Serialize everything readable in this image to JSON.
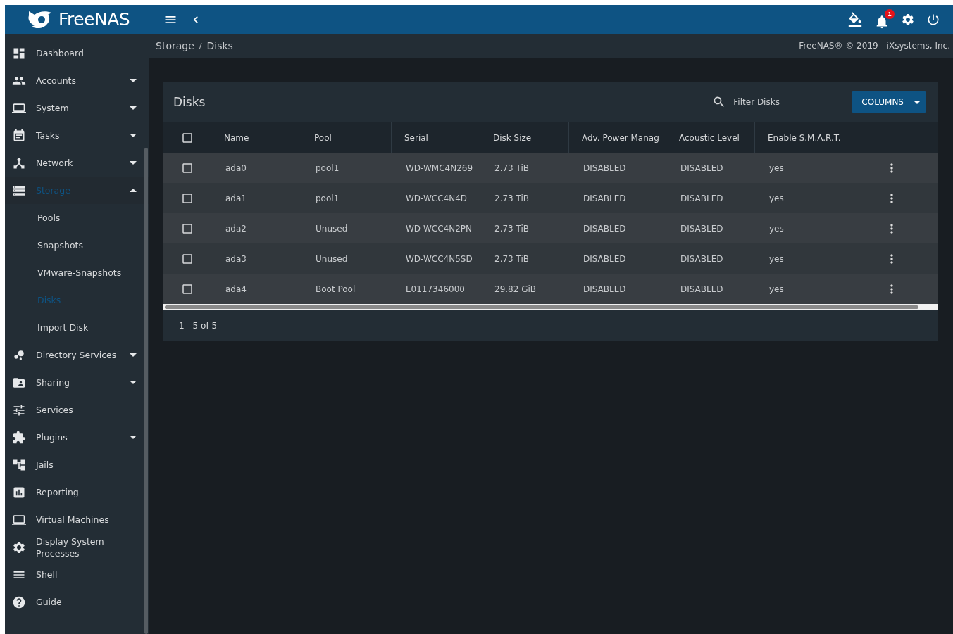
{
  "topbar": {
    "logo": "FreeNAS",
    "notification_count": "1"
  },
  "breadcrumb": {
    "items": [
      "Storage",
      "Disks"
    ],
    "separator": "/",
    "copyright": "FreeNAS® © 2019 - iXsystems, Inc."
  },
  "sidebar": {
    "items": [
      {
        "label": "Dashboard",
        "selected": false
      },
      {
        "label": "Accounts",
        "expanded": false,
        "selected": false
      },
      {
        "label": "System",
        "expanded": false,
        "selected": false
      },
      {
        "label": "Tasks",
        "expanded": false,
        "selected": false
      },
      {
        "label": "Network",
        "expanded": false,
        "selected": false
      },
      {
        "label": "Storage",
        "expanded": true,
        "selected": true,
        "children": [
          {
            "label": "Pools",
            "selected": false
          },
          {
            "label": "Snapshots",
            "selected": false
          },
          {
            "label": "VMware-Snapshots",
            "selected": false
          },
          {
            "label": "Disks",
            "selected": true
          },
          {
            "label": "Import Disk",
            "selected": false
          }
        ]
      },
      {
        "label": "Directory Services",
        "expanded": false,
        "selected": false
      },
      {
        "label": "Sharing",
        "expanded": false,
        "selected": false
      },
      {
        "label": "Services",
        "selected": false
      },
      {
        "label": "Plugins",
        "expanded": false,
        "selected": false
      },
      {
        "label": "Jails",
        "selected": false
      },
      {
        "label": "Reporting",
        "selected": false
      },
      {
        "label": "Virtual Machines",
        "selected": false
      },
      {
        "label": "Display System Processes",
        "selected": false
      },
      {
        "label": "Shell",
        "selected": false
      },
      {
        "label": "Guide",
        "selected": false
      }
    ]
  },
  "card": {
    "title": "Disks",
    "filter": {
      "placeholder": "Filter Disks"
    },
    "columns_button": "COLUMNS",
    "table": {
      "select_all_checked": false,
      "columns": [
        "Name",
        "Pool",
        "Serial",
        "Disk Size",
        "Adv. Power Manag",
        "Acoustic Level",
        "Enable S.M.A.R.T."
      ],
      "rows": [
        {
          "checked": false,
          "cells": [
            "ada0",
            "pool1",
            "WD-WMC4N269",
            "2.73 TiB",
            "DISABLED",
            "DISABLED",
            "yes"
          ]
        },
        {
          "checked": false,
          "cells": [
            "ada1",
            "pool1",
            "WD-WCC4N4D",
            "2.73 TiB",
            "DISABLED",
            "DISABLED",
            "yes"
          ]
        },
        {
          "checked": false,
          "cells": [
            "ada2",
            "Unused",
            "WD-WCC4N2PN",
            "2.73 TiB",
            "DISABLED",
            "DISABLED",
            "yes"
          ]
        },
        {
          "checked": false,
          "cells": [
            "ada3",
            "Unused",
            "WD-WCC4N5SD",
            "2.73 TiB",
            "DISABLED",
            "DISABLED",
            "yes"
          ]
        },
        {
          "checked": false,
          "cells": [
            "ada4",
            "Boot Pool",
            "E0117346000",
            "29.82 GiB",
            "DISABLED",
            "DISABLED",
            "yes"
          ]
        }
      ]
    },
    "pagination": "1 - 5 of 5"
  }
}
